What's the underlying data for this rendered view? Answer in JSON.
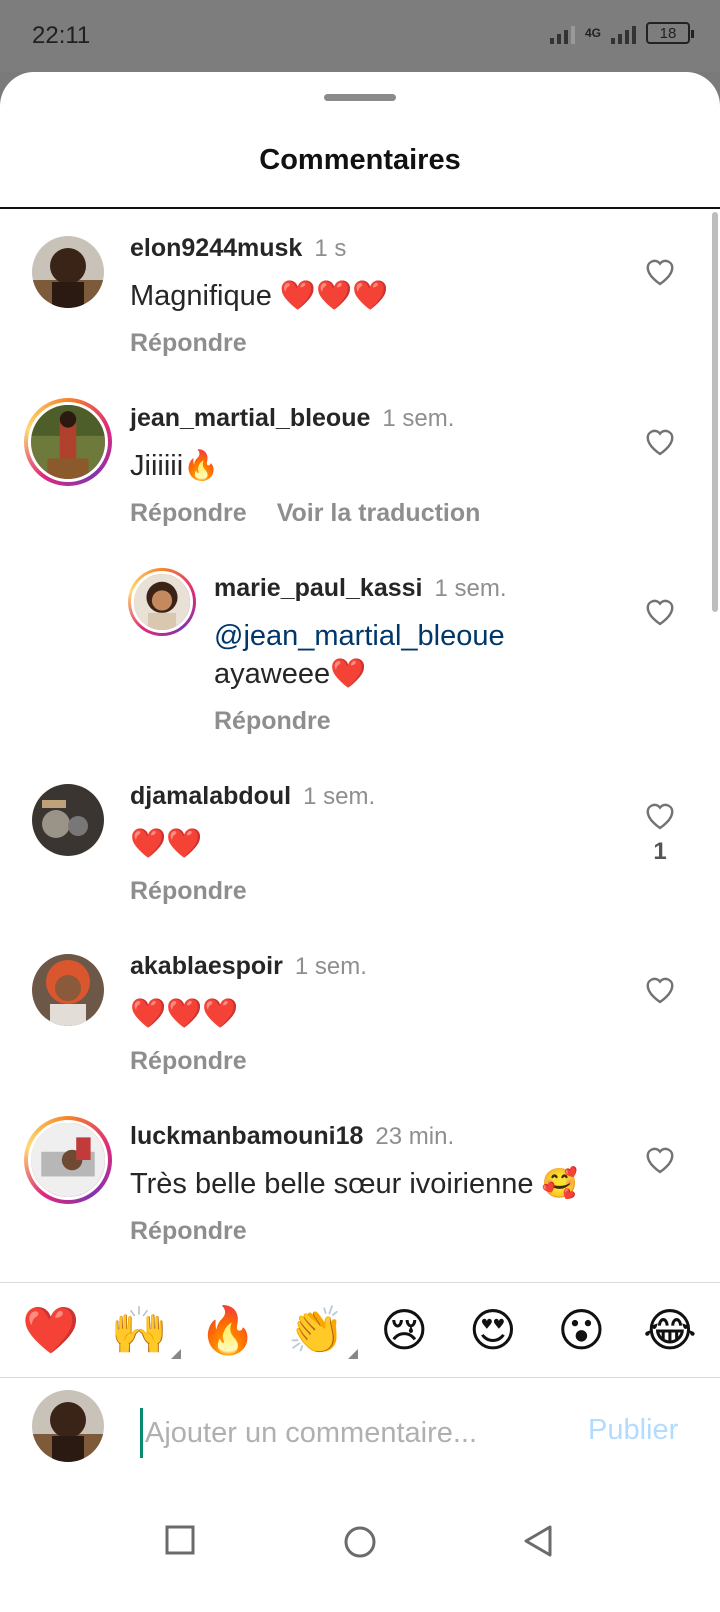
{
  "status_bar": {
    "time": "22:11",
    "network": "4G",
    "battery": "18"
  },
  "sheet": {
    "title": "Commentaires"
  },
  "comments": [
    {
      "user": "elon9244musk",
      "time": "1 s",
      "text": "Magnifique ❤️❤️❤️",
      "reply": "Répondre"
    },
    {
      "user": "jean_martial_bleoue",
      "time": "1 sem.",
      "text": "Jiiiiii🔥",
      "reply": "Répondre",
      "translate": "Voir la traduction"
    },
    {
      "user": "marie_paul_kassi",
      "time": "1 sem.",
      "mention": "@jean_martial_bleoue",
      "text": "ayaweee❤️",
      "reply": "Répondre"
    },
    {
      "user": "djamalabdoul",
      "time": "1 sem.",
      "text": "❤️❤️",
      "reply": "Répondre",
      "likes": "1"
    },
    {
      "user": "akablaespoir",
      "time": "1 sem.",
      "text": "❤️❤️❤️",
      "reply": "Répondre"
    },
    {
      "user": "luckmanbamouni18",
      "time": "23 min.",
      "text": "Très belle  belle sœur ivoirienne 🥰",
      "reply": "Répondre"
    }
  ],
  "reactions": [
    "❤️",
    "🙌",
    "🔥",
    "👏",
    "😢",
    "😍",
    "😮",
    "😂"
  ],
  "composer": {
    "placeholder": "Ajouter un commentaire...",
    "publish": "Publier"
  },
  "colors": {
    "link": "#00376b",
    "muted": "#8e8e8e",
    "publish_disabled": "#b3dbff"
  }
}
